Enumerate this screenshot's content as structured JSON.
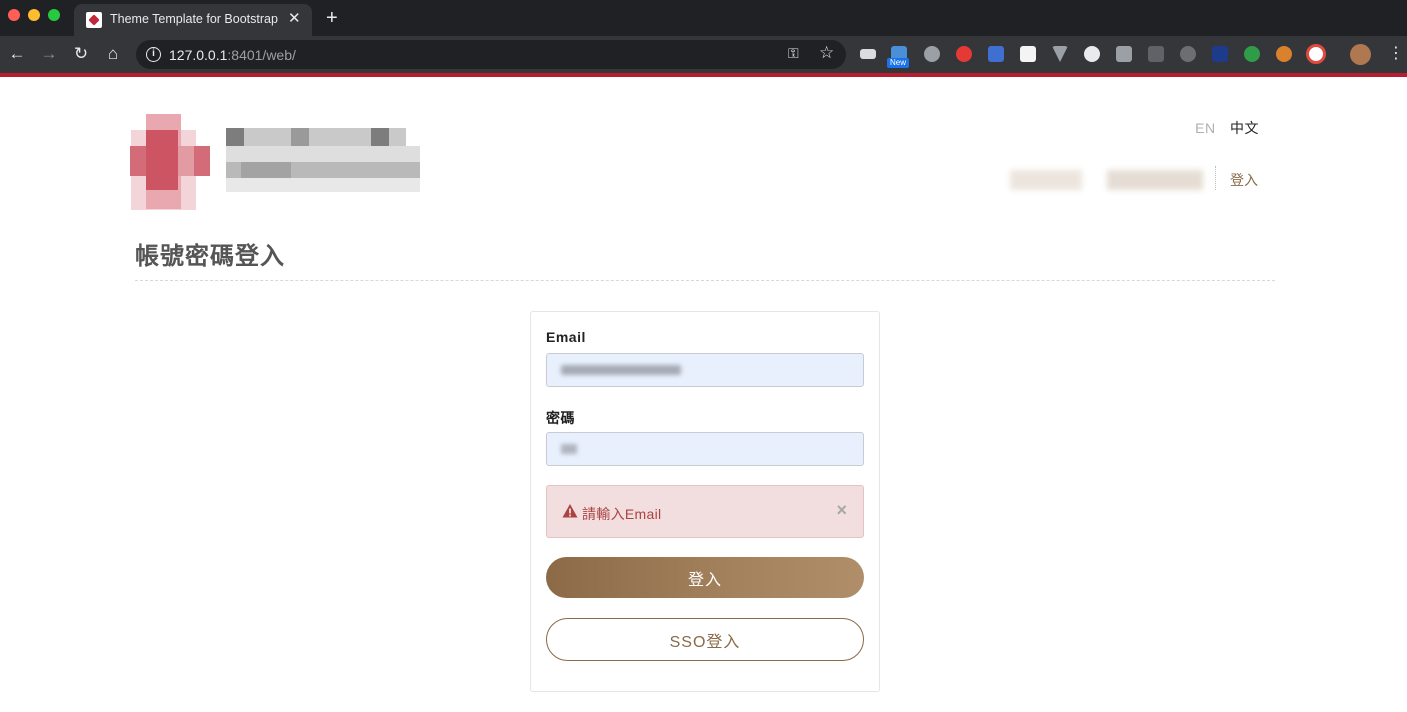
{
  "browser": {
    "tab_title": "Theme Template for Bootstrap",
    "tab_close": "✕",
    "new_tab": "+",
    "url_host": "127.0.0.1",
    "url_rest": ":8401/web/",
    "extension_badge": "New"
  },
  "header": {
    "lang_en": "EN",
    "lang_zh": "中文",
    "nav_login": "登入"
  },
  "page": {
    "title": "帳號密碼登入"
  },
  "form": {
    "email_label": "Email",
    "password_label": "密碼",
    "alert_message": "請輸入Email",
    "alert_close": "×",
    "login_button": "登入",
    "sso_button": "SSO登入"
  },
  "colors": {
    "chrome_dark": "#202124",
    "accent_red": "#b81c2f",
    "brand_brown": "#8a6a48",
    "alert_bg": "#f2dede",
    "alert_text": "#a94442",
    "input_fill": "#e8f0fe"
  }
}
